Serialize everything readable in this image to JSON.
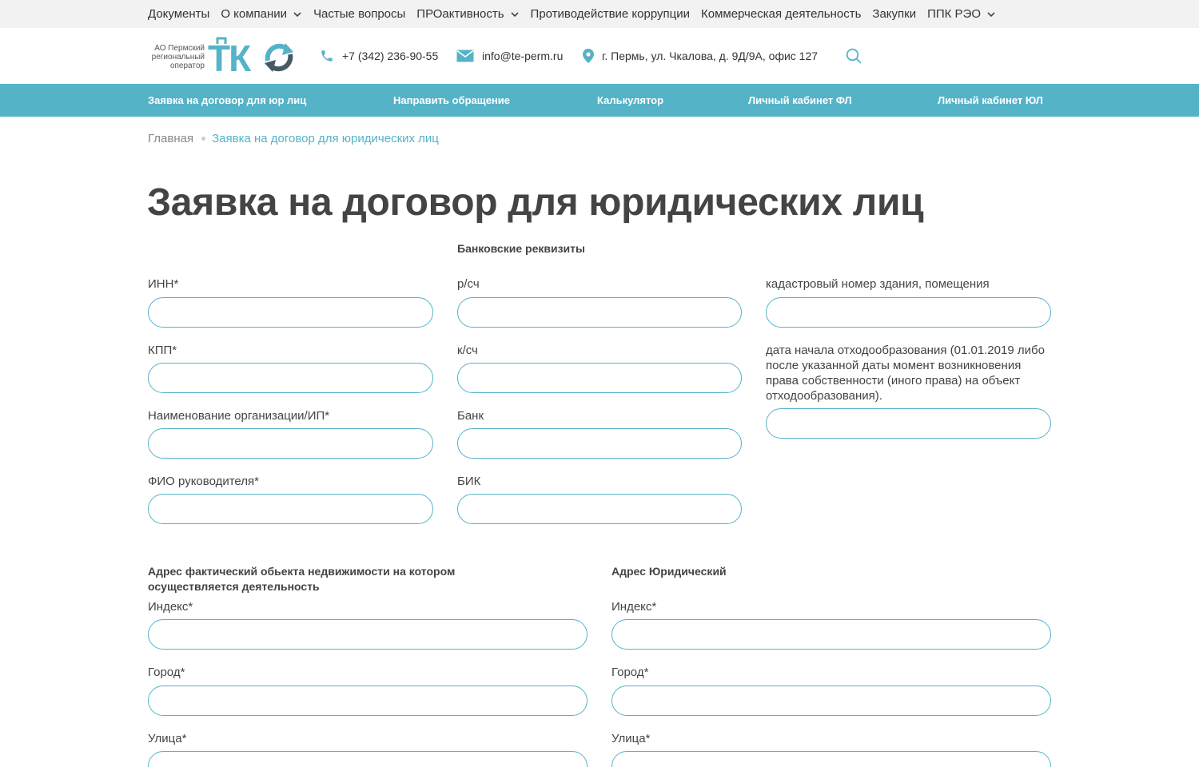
{
  "topnav": {
    "items": [
      {
        "label": "Документы",
        "dropdown": false
      },
      {
        "label": "О компании",
        "dropdown": true
      },
      {
        "label": "Частые вопросы",
        "dropdown": false
      },
      {
        "label": "ПРОактивность",
        "dropdown": true
      },
      {
        "label": "Противодействие коррупции",
        "dropdown": false
      },
      {
        "label": "Коммерческая деятельность",
        "dropdown": false
      },
      {
        "label": "Закупки",
        "dropdown": false
      },
      {
        "label": "ППК РЭО",
        "dropdown": true
      }
    ]
  },
  "header": {
    "logo_line1": "АО Пермский",
    "logo_line2": "региональный",
    "logo_line3": "оператор",
    "logo_mark": "ТКО",
    "phone": "+7 (342) 236-90-55",
    "email": "info@te-perm.ru",
    "address": "г. Пермь, ул. Чкалова, д. 9Д/9А, офис 127",
    "phone_icon": "phone-icon",
    "email_icon": "envelope-icon",
    "address_icon": "map-pin-icon",
    "search_icon": "search-icon"
  },
  "mainnav": {
    "items": [
      "Заявка на договор для юр лиц",
      "Направить обращение",
      "Калькулятор",
      "Личный кабинет ФЛ",
      "Личный кабинет ЮЛ"
    ]
  },
  "breadcrumb": {
    "home": "Главная",
    "current": "Заявка на договор для юридических лиц"
  },
  "page_title": "Заявка на договор для юридических лиц",
  "form": {
    "bank_section_title": "Банковские реквизиты",
    "col1": [
      {
        "label": "ИНН*",
        "value": ""
      },
      {
        "label": "КПП*",
        "value": ""
      },
      {
        "label": "Наименование организации/ИП*",
        "value": ""
      },
      {
        "label": "ФИО руководителя*",
        "value": ""
      }
    ],
    "col2": [
      {
        "label": "р/сч",
        "value": ""
      },
      {
        "label": "к/сч",
        "value": ""
      },
      {
        "label": "Банк",
        "value": ""
      },
      {
        "label": "БИК",
        "value": ""
      }
    ],
    "col3": [
      {
        "label": "кадастровый номер здания, помещения",
        "value": ""
      },
      {
        "label": "дата начала отходообразования (01.01.2019 либо после указанной даты момент возникновения права собственности (иного права) на объект отходообразования).",
        "value": ""
      }
    ],
    "actual_address": {
      "title": "Адрес фактический обьекта недвижимости на котором осуществляется деятельность",
      "fields": [
        {
          "label": "Индекс*",
          "value": ""
        },
        {
          "label": "Город*",
          "value": ""
        },
        {
          "label": "Улица*",
          "value": ""
        }
      ]
    },
    "legal_address": {
      "title": "Адрес Юридический",
      "fields": [
        {
          "label": "Индекс*",
          "value": ""
        },
        {
          "label": "Город*",
          "value": ""
        },
        {
          "label": "Улица*",
          "value": ""
        }
      ]
    }
  },
  "colors": {
    "accent": "#55b3c8",
    "topbar_bg": "#f2f2f2",
    "text": "#444444"
  }
}
